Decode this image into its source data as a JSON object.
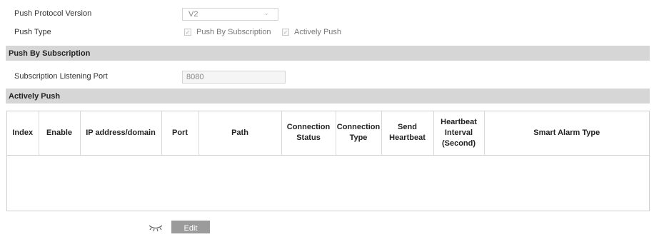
{
  "push_protocol_version": {
    "label": "Push Protocol Version",
    "value": "V2"
  },
  "push_type": {
    "label": "Push Type",
    "options": [
      {
        "label": "Push By Subscription",
        "checked": true
      },
      {
        "label": "Actively Push",
        "checked": true
      }
    ]
  },
  "push_by_subscription": {
    "section_title": "Push By Subscription",
    "listening_port_label": "Subscription Listening Port",
    "listening_port_value": "8080"
  },
  "actively_push": {
    "section_title": "Actively Push",
    "columns": [
      "Index",
      "Enable",
      "IP address/domain",
      "Port",
      "Path",
      "Connection Status",
      "Connection Type",
      "Send Heartbeat",
      "Heartbeat Interval (Second)",
      "Smart Alarm Type"
    ],
    "rows": []
  },
  "footer": {
    "edit_label": "Edit",
    "eye_icon": "eye-closed-icon"
  },
  "colors": {
    "section_bg": "#d6d6d6",
    "button_bg": "#9b9b9b",
    "border": "#cfcfcf"
  }
}
